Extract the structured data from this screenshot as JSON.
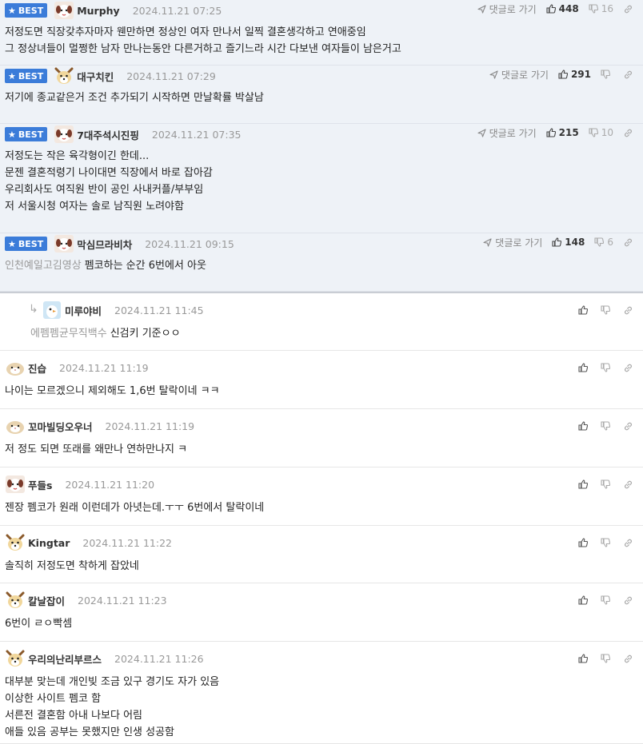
{
  "labels": {
    "best": "BEST",
    "goto_reply": "댓글로 가기"
  },
  "comments": [
    {
      "best": true,
      "nick": "Murphy",
      "date": "2024.11.21 07:25",
      "likes": "448",
      "dislikes": "16",
      "lines": [
        "저정도면 직장갖추자마자 웬만하면 정상인 여자 만나서 일찍 결혼생각하고 연애중임",
        "그 정상녀들이 멀쩡한 남자 만나는동안 다른거하고 즐기느라 시간 다보낸 여자들이 남은거고"
      ]
    },
    {
      "best": true,
      "nick": "대구치킨",
      "date": "2024.11.21 07:29",
      "likes": "291",
      "dislikes": "",
      "lines": [
        "저기에 종교같은거 조건 추가되기 시작하면 만날확률 박살남"
      ]
    },
    {
      "best": true,
      "nick": "7대주석시진핑",
      "date": "2024.11.21 07:35",
      "likes": "215",
      "dislikes": "10",
      "lines": [
        "저정도는 작은 육각형이긴 한데...",
        "문젠 결혼적령기 나이대면 직장에서 바로 잡아감",
        "우리회사도 여직원 반이 공인 사내커플/부부임",
        "저 서울시청 여자는 솔로 남직원 노려야함"
      ]
    },
    {
      "best": true,
      "nick": "막심므라비차",
      "date": "2024.11.21 09:15",
      "likes": "148",
      "dislikes": "6",
      "mention": "인천예일고김영상",
      "lines": [
        "펨코하는 순간 6번에서 아웃"
      ]
    },
    {
      "reply": true,
      "nick": "미루야비",
      "date": "2024.11.21 11:45",
      "mention": "에펨펨균무직백수",
      "lines": [
        "신검키 기준ㅇㅇ"
      ]
    },
    {
      "nick": "진습",
      "date": "2024.11.21 11:19",
      "lines": [
        "나이는 모르겠으니 제외해도 1,6번 탈락이네 ㅋㅋ"
      ]
    },
    {
      "nick": "꼬마빌딩오우너",
      "date": "2024.11.21 11:19",
      "lines": [
        "저 정도 되면 또래를 왜만나 연하만나지 ㅋ"
      ]
    },
    {
      "nick": "푸들s",
      "date": "2024.11.21 11:20",
      "lines": [
        "젠장 펨코가 원래 이런데가 아녓는데.ㅜㅜ 6번에서 탈락이네"
      ]
    },
    {
      "nick": "Kingtar",
      "date": "2024.11.21 11:22",
      "lines": [
        "솔직히 저정도면 착하게 잡았네"
      ]
    },
    {
      "nick": "칼날잡이",
      "date": "2024.11.21 11:23",
      "lines": [
        "6번이 ㄹㅇ빡셈"
      ]
    },
    {
      "nick": "우리의난리부르스",
      "date": "2024.11.21 11:26",
      "lines": [
        "대부분 맞는데 개인빚 조금 있구 경기도 자가 있음",
        "이상한 사이트 펨코 함",
        "서른전 결혼함 아내 나보다 어림",
        "애들 있음 공부는 못했지만 인생 성공함"
      ]
    }
  ],
  "colors": {
    "best_bg": "#eef2f7",
    "badge": "#3b7cd9",
    "date": "#999999",
    "mention": "#999999"
  },
  "icons": [
    "star-icon",
    "reply-arrow-icon",
    "thumbs-up-icon",
    "thumbs-down-icon",
    "link-icon",
    "avatar-icon"
  ]
}
